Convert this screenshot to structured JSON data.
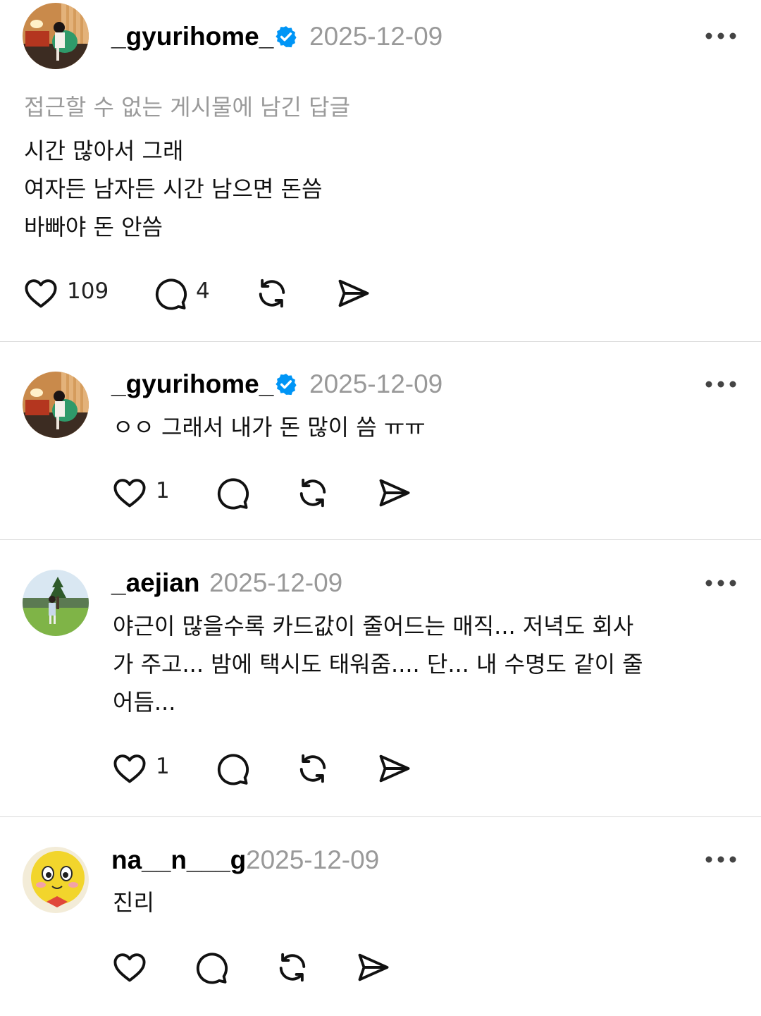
{
  "posts": [
    {
      "username": "_gyurihome_",
      "verified": true,
      "date": "2025-12-09",
      "context": "접근할 수 없는 게시물에 남긴 답글",
      "lines": [
        "시간 많아서 그래",
        "여자든 남자든 시간 남으면 돈씀",
        "바빠야 돈 안씀"
      ],
      "likes": "109",
      "replies": "4"
    },
    {
      "username": "_gyurihome_",
      "verified": true,
      "date": "2025-12-09",
      "lines": [
        "ㅇㅇ 그래서 내가 돈 많이 씀 ㅠㅠ"
      ],
      "likes": "1",
      "replies": ""
    },
    {
      "username": "_aejian",
      "verified": false,
      "date": "2025-12-09",
      "lines": [
        "야근이 많을수록 카드값이 줄어드는 매직... 저녁도 회사",
        "가 주고... 밤에 택시도 태워줌.... 단... 내 수명도 같이 줄",
        "어듬..."
      ],
      "likes": "1",
      "replies": ""
    },
    {
      "username": "na__n___g",
      "verified": false,
      "date": "2025-12-09",
      "lines": [
        "진리"
      ],
      "likes": "",
      "replies": ""
    }
  ],
  "icons": {
    "like": "heart-icon",
    "reply": "comment-bubble-icon",
    "repost": "repost-icon",
    "share": "send-icon",
    "more": "more-dots-icon",
    "verified": "verified-badge-icon"
  },
  "colors": {
    "verified": "#0095F6",
    "secondary_text": "#999999",
    "divider": "#D9D9D9"
  }
}
